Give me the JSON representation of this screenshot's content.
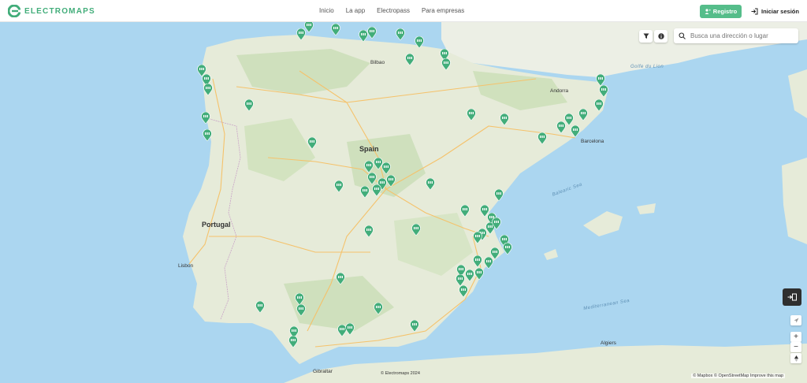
{
  "brand": {
    "name": "ELECTROMAPS",
    "accent": "#42ad7a"
  },
  "nav": [
    {
      "label": "Inicio"
    },
    {
      "label": "La app"
    },
    {
      "label": "Electropass"
    },
    {
      "label": "Para empresas"
    }
  ],
  "header": {
    "register_label": "Registro",
    "login_label": "Iniciar sesión"
  },
  "search": {
    "placeholder": "Busca una dirección o lugar"
  },
  "map": {
    "country_labels": [
      "Spain",
      "Portugal"
    ],
    "cities": [
      "Barcelona",
      "Andorra",
      "Lisbon",
      "Algiers",
      "Gibraltar",
      "Bilbao"
    ],
    "seas": [
      "Balearic Sea",
      "Mediterranean Sea",
      "Golfe du Lion"
    ],
    "copyright": "© Electromaps 2024",
    "attribution": "© Mapbox © OpenStreetMap  Improve this map",
    "mapbox_logo": "mapbox"
  },
  "icons": {
    "filter": "filter-icon",
    "info": "info-icon",
    "search": "search-icon",
    "login": "login-icon",
    "register": "user-plus-icon",
    "pin": "charging-pin-icon"
  }
}
